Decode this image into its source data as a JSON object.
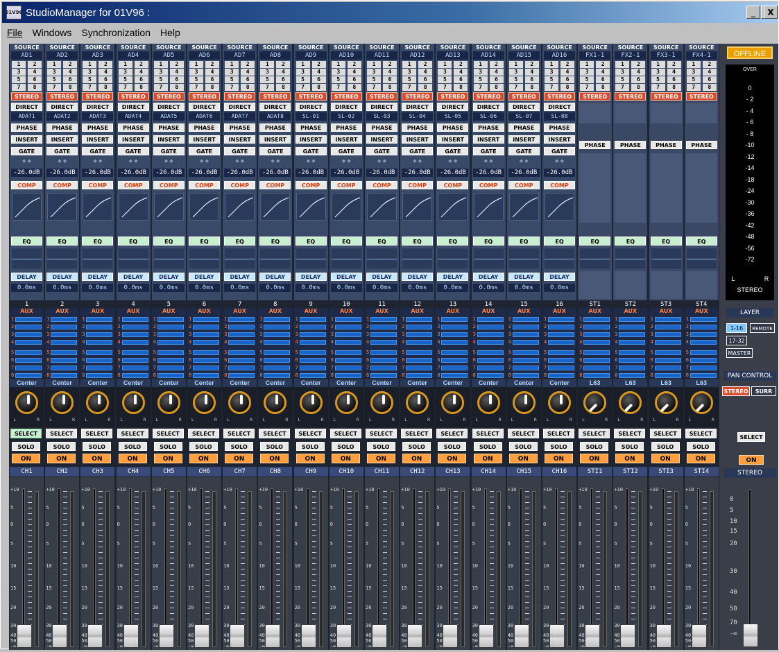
{
  "window": {
    "title": "StudioManager for 01V96 :",
    "icon_text": "01V96"
  },
  "window_buttons": {
    "minimize": "_",
    "maximize": "□",
    "close": "X"
  },
  "menu": [
    {
      "label": "File"
    },
    {
      "label": "Windows"
    },
    {
      "label": "Synchronization"
    },
    {
      "label": "Help"
    }
  ],
  "labels": {
    "source": "SOURCE",
    "stereo": "STEREO",
    "direct": "DIRECT",
    "phase": "PHASE",
    "insert": "INSERT",
    "gate": "GATE",
    "comp": "COMP",
    "eq": "EQ",
    "delay": "DELAY",
    "aux": "AUX",
    "select": "SELECT",
    "solo": "SOLO",
    "on": "ON"
  },
  "channels": [
    {
      "num": "1",
      "source": "AD1",
      "adat": "ADAT1",
      "gate_val": "-26.0dB",
      "delay_val": "0.0ms",
      "pan": "Center",
      "name": "CH1",
      "selected": true
    },
    {
      "num": "2",
      "source": "AD2",
      "adat": "ADAT2",
      "gate_val": "-26.0dB",
      "delay_val": "0.0ms",
      "pan": "Center",
      "name": "CH2"
    },
    {
      "num": "3",
      "source": "AD3",
      "adat": "ADAT3",
      "gate_val": "-26.0dB",
      "delay_val": "0.0ms",
      "pan": "Center",
      "name": "CH3"
    },
    {
      "num": "4",
      "source": "AD4",
      "adat": "ADAT4",
      "gate_val": "-26.0dB",
      "delay_val": "0.0ms",
      "pan": "Center",
      "name": "CH4"
    },
    {
      "num": "5",
      "source": "AD5",
      "adat": "ADAT5",
      "gate_val": "-26.0dB",
      "delay_val": "0.0ms",
      "pan": "Center",
      "name": "CH5"
    },
    {
      "num": "6",
      "source": "AD6",
      "adat": "ADAT6",
      "gate_val": "-26.0dB",
      "delay_val": "0.0ms",
      "pan": "Center",
      "name": "CH6"
    },
    {
      "num": "7",
      "source": "AD7",
      "adat": "ADAT7",
      "gate_val": "-26.0dB",
      "delay_val": "0.0ms",
      "pan": "Center",
      "name": "CH7"
    },
    {
      "num": "8",
      "source": "AD8",
      "adat": "ADAT8",
      "gate_val": "-26.0dB",
      "delay_val": "0.0ms",
      "pan": "Center",
      "name": "CH8"
    },
    {
      "num": "9",
      "source": "AD9",
      "adat": "SL-01",
      "gate_val": "-26.0dB",
      "delay_val": "0.0ms",
      "pan": "Center",
      "name": "CH9"
    },
    {
      "num": "10",
      "source": "AD10",
      "adat": "SL-02",
      "gate_val": "-26.0dB",
      "delay_val": "0.0ms",
      "pan": "Center",
      "name": "CH10"
    },
    {
      "num": "11",
      "source": "AD11",
      "adat": "SL-03",
      "gate_val": "-26.0dB",
      "delay_val": "0.0ms",
      "pan": "Center",
      "name": "CH11"
    },
    {
      "num": "12",
      "source": "AD12",
      "adat": "SL-04",
      "gate_val": "-26.0dB",
      "delay_val": "0.0ms",
      "pan": "Center",
      "name": "CH12"
    },
    {
      "num": "13",
      "source": "AD13",
      "adat": "SL-05",
      "gate_val": "-26.0dB",
      "delay_val": "0.0ms",
      "pan": "Center",
      "name": "CH13"
    },
    {
      "num": "14",
      "source": "AD14",
      "adat": "SL-06",
      "gate_val": "-26.0dB",
      "delay_val": "0.0ms",
      "pan": "Center",
      "name": "CH14"
    },
    {
      "num": "15",
      "source": "AD15",
      "adat": "SL-07",
      "gate_val": "-26.0dB",
      "delay_val": "0.0ms",
      "pan": "Center",
      "name": "CH15"
    },
    {
      "num": "16",
      "source": "AD16",
      "adat": "SL-08",
      "gate_val": "-26.0dB",
      "delay_val": "0.0ms",
      "pan": "Center",
      "name": "CH16"
    },
    {
      "num": "ST1",
      "source": "FX1-1",
      "pan": "L63",
      "name": "STI1",
      "fx": true
    },
    {
      "num": "ST2",
      "source": "FX2-1",
      "pan": "L63",
      "name": "STI2",
      "fx": true
    },
    {
      "num": "ST3",
      "source": "FX3-1",
      "pan": "L63",
      "name": "STI3",
      "fx": true
    },
    {
      "num": "ST4",
      "source": "FX4-1",
      "pan": "L63",
      "name": "STI4",
      "fx": true
    }
  ],
  "master": {
    "status": "OFFLINE",
    "meter_labels": [
      "OVER",
      "0",
      "- 2",
      "- 4",
      "- 6",
      "- 8",
      "-10",
      "-12",
      "-14",
      "-18",
      "-24",
      "-30",
      "-36",
      "-42",
      "-48",
      "-56",
      "-72"
    ],
    "meter_l": "L",
    "meter_r": "R",
    "meter_name": "STEREO",
    "layer_title": "LAYER",
    "layer_1_16": "1-16",
    "layer_remote": "REMOTE",
    "layer_17_32": "17-32",
    "layer_master": "MASTER",
    "pan_control_title": "PAN CONTROL",
    "pan_stereo": "STEREO",
    "pan_surr": "SURR",
    "select": "SELECT",
    "on": "ON",
    "name": "STEREO",
    "fader_scale": [
      "0",
      "5",
      "10",
      "15",
      "20",
      "30",
      "40",
      "50",
      "70",
      "-∞"
    ]
  },
  "fader_scale": [
    "+10",
    "5",
    "0",
    "5",
    "10",
    "15",
    "20",
    "30",
    "40",
    "50",
    "-∞"
  ],
  "colors": {
    "accent_offline": "#e8a000",
    "on_button": "#ffa040",
    "stereo_button": "#d84b2a"
  }
}
